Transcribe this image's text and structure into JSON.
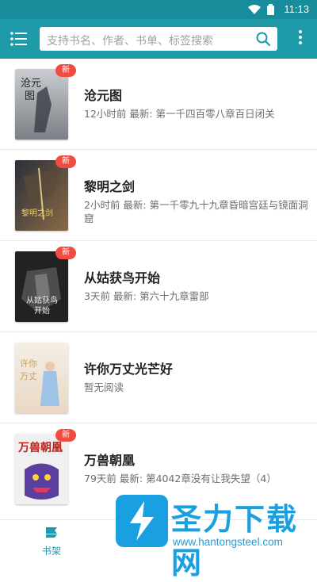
{
  "status_bar": {
    "time": "11:13"
  },
  "search": {
    "placeholder": "支持书名、作者、书单、标签搜索"
  },
  "books": [
    {
      "title": "沧元图",
      "subtitle": "12小时前 最新: 第一千四百零八章百日闭关",
      "badge": "新",
      "cover_text": "沧元图",
      "cover_colors": [
        "#c9ccd0",
        "#7b8086"
      ]
    },
    {
      "title": "黎明之剑",
      "subtitle": "2小时前 最新: 第一千零九十九章昏暗宫廷与镜面洞窟",
      "badge": "新",
      "cover_text": "黎明之剑",
      "cover_colors": [
        "#2b2f3a",
        "#8a6a45"
      ]
    },
    {
      "title": "从姑获鸟开始",
      "subtitle": "3天前 最新: 第六十九章雷部",
      "badge": "新",
      "cover_text": "从姑获鸟开始",
      "cover_colors": [
        "#2a2a2a",
        "#5e5e5e"
      ]
    },
    {
      "title": "许你万丈光芒好",
      "subtitle": "暂无阅读",
      "badge": "",
      "cover_text": "许你万丈光芒好",
      "cover_colors": [
        "#f4efe6",
        "#e9d7c4"
      ]
    },
    {
      "title": "万兽朝凰",
      "subtitle": "79天前 最新: 第4042章没有让我失望（4）",
      "badge": "新",
      "cover_text": "万兽朝凰",
      "cover_colors": [
        "#f0f0f0",
        "#5a3ea0"
      ]
    }
  ],
  "bottom_nav": {
    "shelf_label": "书架"
  },
  "watermark": {
    "text": "圣力下载网",
    "url": "www.hantongsteel.com"
  },
  "colors": {
    "primary": "#1f9aa8",
    "status_bar": "#178c9b",
    "badge": "#f24b3f",
    "watermark": "#1a9fe0"
  },
  "icons": {
    "menu": "list-menu-icon",
    "search": "search-icon",
    "more": "more-vert-icon",
    "shelf": "bookshelf-icon"
  }
}
